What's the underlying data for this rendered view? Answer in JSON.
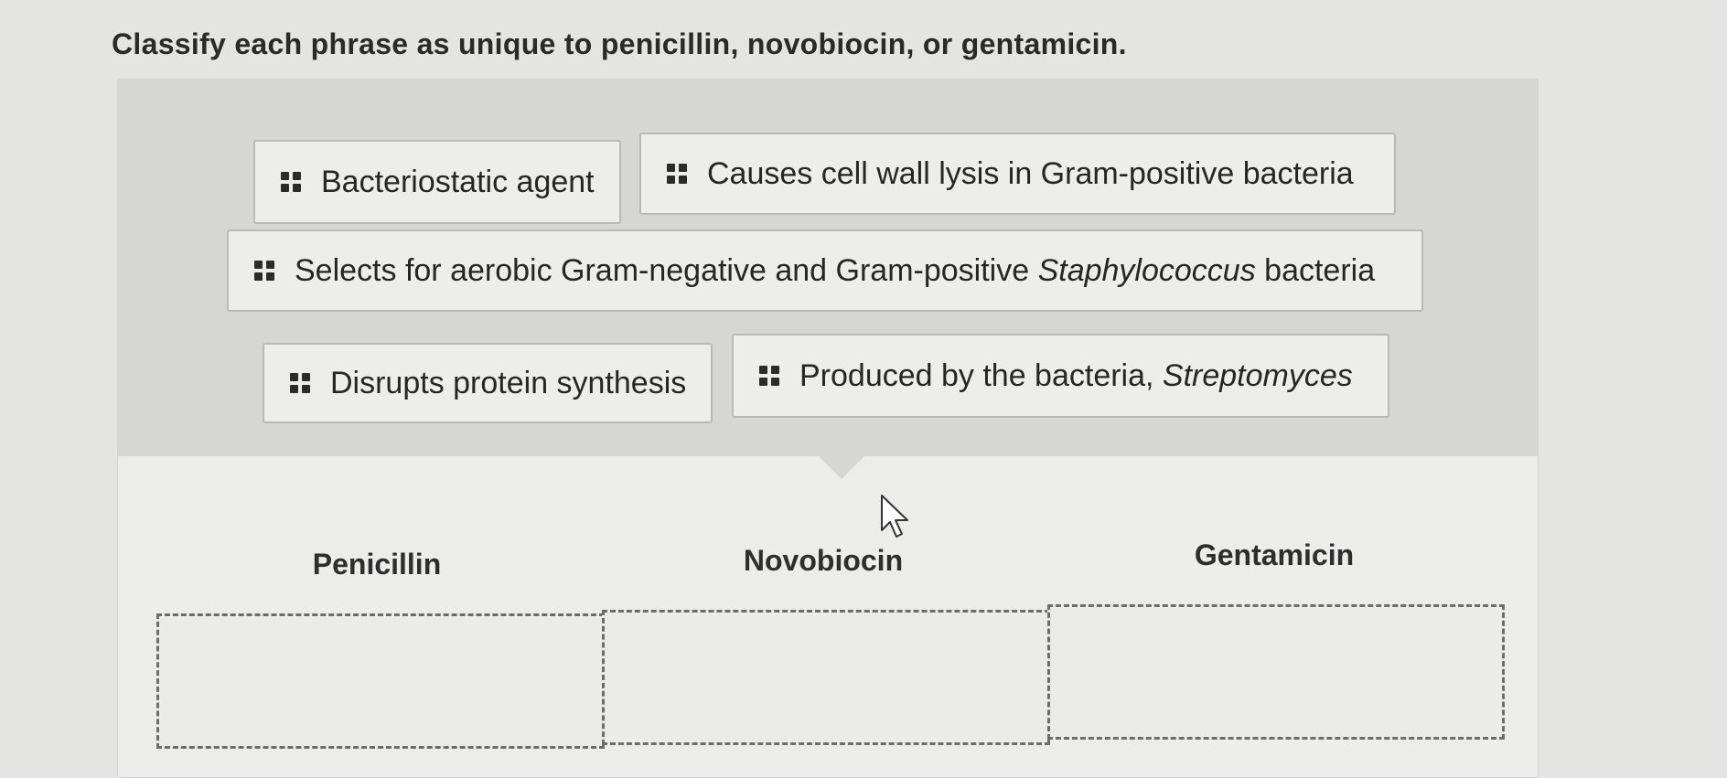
{
  "prompt": "Classify each phrase as unique to penicillin, novobiocin, or gentamicin.",
  "items": [
    {
      "text": "Bacteriostatic agent",
      "italic": ""
    },
    {
      "text": "Causes cell wall lysis in Gram-positive bacteria",
      "italic": ""
    },
    {
      "text": "Selects for aerobic Gram-negative and Gram-positive ",
      "italic": "Staphylococcus",
      "after": " bacteria"
    },
    {
      "text": "Disrupts protein synthesis",
      "italic": ""
    },
    {
      "text": "Produced by the bacteria, ",
      "italic": "Streptomyces"
    }
  ],
  "categories": [
    {
      "label": "Penicillin"
    },
    {
      "label": "Novobiocin"
    },
    {
      "label": "Gentamicin"
    }
  ],
  "icons": {
    "drag_handle": "drag-handle-icon",
    "cursor": "mouse-pointer-icon"
  }
}
